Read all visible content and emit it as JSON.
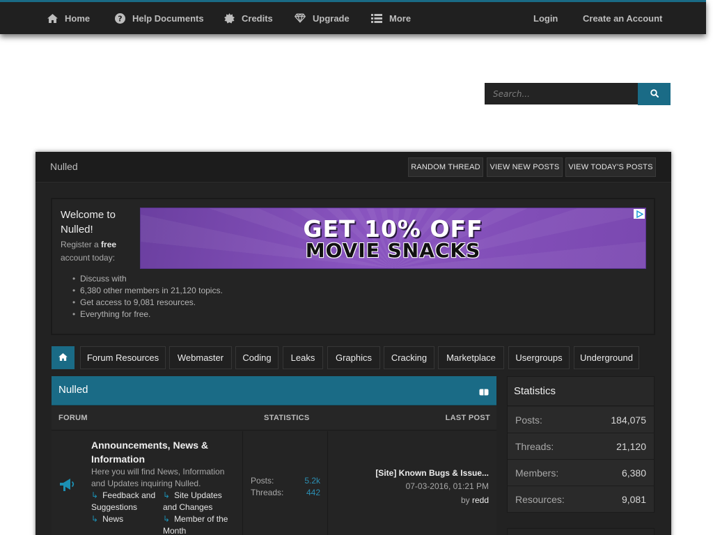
{
  "topnav": {
    "home": "Home",
    "help": "Help Documents",
    "credits": "Credits",
    "upgrade": "Upgrade",
    "more": "More",
    "login": "Login",
    "create_account": "Create an Account"
  },
  "search": {
    "placeholder": "Search...",
    "value": ""
  },
  "panel": {
    "title": "Nulled",
    "buttons": {
      "random_thread": "RANDOM THREAD",
      "view_new": "VIEW NEW POSTS",
      "view_today": "VIEW TODAY'S POSTS"
    }
  },
  "welcome": {
    "title": "Welcome to Nulled!",
    "sub_prefix": "Register a ",
    "sub_bold": "free",
    "sub_suffix": " account today:",
    "bullets": [
      "Discuss with",
      "6,380 other members in 21,120 topics.",
      "Get access to 9,081 resources.",
      "Everything for free."
    ]
  },
  "ad": {
    "line1": "GET 10% OFF",
    "line2": "MOVIE SNACKS"
  },
  "categories": [
    "Forum Resources",
    "Webmaster",
    "Coding",
    "Leaks",
    "Graphics",
    "Cracking",
    "Marketplace",
    "Usergroups",
    "Underground"
  ],
  "forum": {
    "section_title": "Nulled",
    "columns": {
      "forum": "FORUM",
      "statistics": "STATISTICS",
      "last_post": "LAST POST"
    },
    "rows": [
      {
        "name": "Announcements, News & Information",
        "description": "Here you will find News, Information and Updates inquiring Nulled.",
        "subforums": [
          "Feedback and Suggestions",
          "Site Updates and Changes",
          "News",
          "Member of the Month"
        ],
        "posts_label": "Posts:",
        "posts": "5.2k",
        "threads_label": "Threads:",
        "threads": "442",
        "last_post": {
          "title": "[Site] Known Bugs & Issue...",
          "date": "07-03-2016, 01:21 PM",
          "by_label": "by",
          "user": "redd"
        }
      }
    ]
  },
  "statistics": {
    "title": "Statistics",
    "rows": [
      {
        "label": "Posts:",
        "value": "184,075"
      },
      {
        "label": "Threads:",
        "value": "21,120"
      },
      {
        "label": "Members:",
        "value": "6,380"
      },
      {
        "label": "Resources:",
        "value": "9,081"
      }
    ]
  },
  "colors": {
    "accent": "#1a6b86",
    "link": "#2c8fb3",
    "panel_bg": "#222222"
  }
}
